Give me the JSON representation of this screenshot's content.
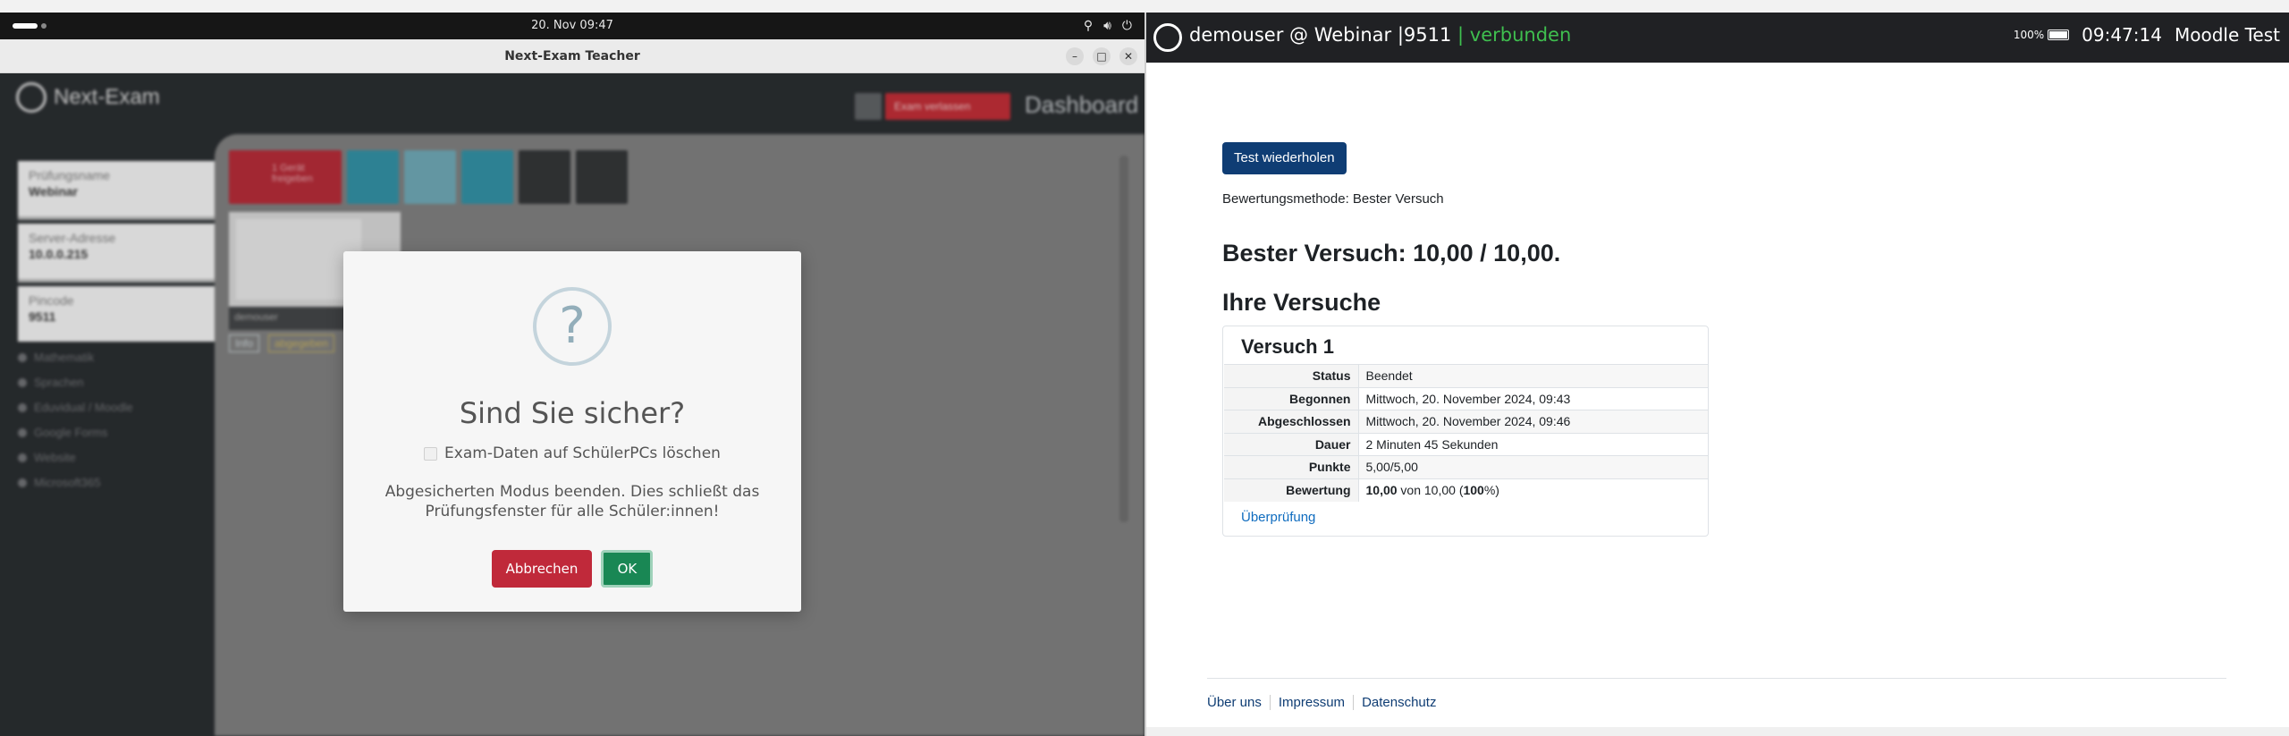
{
  "desktop": {
    "clock": "20. Nov  09:47"
  },
  "window": {
    "title": "Next-Exam Teacher",
    "minimize": "–",
    "maximize": "□",
    "close": "✕"
  },
  "app": {
    "logo_text": "Next-Exam",
    "exit_button": "Exam verlassen",
    "dashboard_label": "Dashboard",
    "fields": [
      {
        "label": "Prüfungsname",
        "value": "Webinar"
      },
      {
        "label": "Server-Adresse",
        "value": "10.0.0.215"
      },
      {
        "label": "Pincode",
        "value": "9511"
      }
    ],
    "menu": [
      "Mathematik",
      "Sprachen",
      "Eduvidual / Moodle",
      "Google Forms",
      "Website",
      "Microsoft365"
    ],
    "toolbar_first": "1 Gerät freigeben",
    "student_name": "demouser",
    "student_info": "Info",
    "student_status": "abgegeben"
  },
  "dialog": {
    "icon": "?",
    "title": "Sind Sie sicher?",
    "checkbox_label": "Exam-Daten auf SchülerPCs löschen",
    "message": "Abgesicherten Modus beenden. Dies schließt das Prüfungsfenster für alle Schüler:innen!",
    "cancel": "Abbrechen",
    "ok": "OK"
  },
  "seb": {
    "user": "demouser @ Webinar |9511",
    "status": "| verbunden",
    "battery": "100%",
    "time": "09:47:14",
    "course": "Moodle Test"
  },
  "moodle": {
    "retry_button": "Test wiederholen",
    "grading_method": "Bewertungsmethode: Bester Versuch",
    "best_attempt": "Bester Versuch: 10,00 / 10,00.",
    "attempts_heading": "Ihre Versuche",
    "attempt_title": "Versuch 1",
    "rows": [
      {
        "label": "Status",
        "value": "Beendet"
      },
      {
        "label": "Begonnen",
        "value": "Mittwoch, 20. November 2024, 09:43"
      },
      {
        "label": "Abgeschlossen",
        "value": "Mittwoch, 20. November 2024, 09:46"
      },
      {
        "label": "Dauer",
        "value": "2 Minuten 45 Sekunden"
      },
      {
        "label": "Punkte",
        "value": "5,00/5,00"
      }
    ],
    "grade_label": "Bewertung",
    "grade_value": "10,00",
    "grade_mid": " von 10,00 (",
    "grade_pct": "100",
    "grade_end": "%)",
    "review_link": "Überprüfung",
    "footer": [
      "Über uns",
      "Impressum",
      "Datenschutz"
    ]
  },
  "colors": {
    "seb_connected": "#3fbf4f",
    "cancel_red": "#c0293a",
    "ok_green": "#198754",
    "moodle_blue": "#0f3d74"
  }
}
